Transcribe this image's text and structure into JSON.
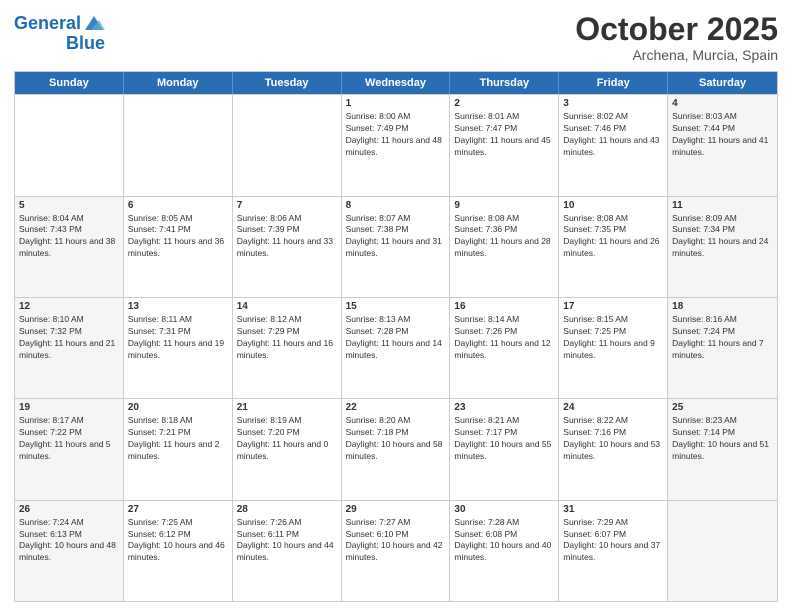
{
  "header": {
    "logo_general": "General",
    "logo_blue": "Blue",
    "month": "October 2025",
    "location": "Archena, Murcia, Spain"
  },
  "weekdays": [
    "Sunday",
    "Monday",
    "Tuesday",
    "Wednesday",
    "Thursday",
    "Friday",
    "Saturday"
  ],
  "rows": [
    [
      {
        "day": "",
        "sunrise": "",
        "sunset": "",
        "daylight": "",
        "shaded": false
      },
      {
        "day": "",
        "sunrise": "",
        "sunset": "",
        "daylight": "",
        "shaded": false
      },
      {
        "day": "",
        "sunrise": "",
        "sunset": "",
        "daylight": "",
        "shaded": false
      },
      {
        "day": "1",
        "sunrise": "Sunrise: 8:00 AM",
        "sunset": "Sunset: 7:49 PM",
        "daylight": "Daylight: 11 hours and 48 minutes.",
        "shaded": false
      },
      {
        "day": "2",
        "sunrise": "Sunrise: 8:01 AM",
        "sunset": "Sunset: 7:47 PM",
        "daylight": "Daylight: 11 hours and 45 minutes.",
        "shaded": false
      },
      {
        "day": "3",
        "sunrise": "Sunrise: 8:02 AM",
        "sunset": "Sunset: 7:46 PM",
        "daylight": "Daylight: 11 hours and 43 minutes.",
        "shaded": false
      },
      {
        "day": "4",
        "sunrise": "Sunrise: 8:03 AM",
        "sunset": "Sunset: 7:44 PM",
        "daylight": "Daylight: 11 hours and 41 minutes.",
        "shaded": true
      }
    ],
    [
      {
        "day": "5",
        "sunrise": "Sunrise: 8:04 AM",
        "sunset": "Sunset: 7:43 PM",
        "daylight": "Daylight: 11 hours and 38 minutes.",
        "shaded": true
      },
      {
        "day": "6",
        "sunrise": "Sunrise: 8:05 AM",
        "sunset": "Sunset: 7:41 PM",
        "daylight": "Daylight: 11 hours and 36 minutes.",
        "shaded": false
      },
      {
        "day": "7",
        "sunrise": "Sunrise: 8:06 AM",
        "sunset": "Sunset: 7:39 PM",
        "daylight": "Daylight: 11 hours and 33 minutes.",
        "shaded": false
      },
      {
        "day": "8",
        "sunrise": "Sunrise: 8:07 AM",
        "sunset": "Sunset: 7:38 PM",
        "daylight": "Daylight: 11 hours and 31 minutes.",
        "shaded": false
      },
      {
        "day": "9",
        "sunrise": "Sunrise: 8:08 AM",
        "sunset": "Sunset: 7:36 PM",
        "daylight": "Daylight: 11 hours and 28 minutes.",
        "shaded": false
      },
      {
        "day": "10",
        "sunrise": "Sunrise: 8:08 AM",
        "sunset": "Sunset: 7:35 PM",
        "daylight": "Daylight: 11 hours and 26 minutes.",
        "shaded": false
      },
      {
        "day": "11",
        "sunrise": "Sunrise: 8:09 AM",
        "sunset": "Sunset: 7:34 PM",
        "daylight": "Daylight: 11 hours and 24 minutes.",
        "shaded": true
      }
    ],
    [
      {
        "day": "12",
        "sunrise": "Sunrise: 8:10 AM",
        "sunset": "Sunset: 7:32 PM",
        "daylight": "Daylight: 11 hours and 21 minutes.",
        "shaded": true
      },
      {
        "day": "13",
        "sunrise": "Sunrise: 8:11 AM",
        "sunset": "Sunset: 7:31 PM",
        "daylight": "Daylight: 11 hours and 19 minutes.",
        "shaded": false
      },
      {
        "day": "14",
        "sunrise": "Sunrise: 8:12 AM",
        "sunset": "Sunset: 7:29 PM",
        "daylight": "Daylight: 11 hours and 16 minutes.",
        "shaded": false
      },
      {
        "day": "15",
        "sunrise": "Sunrise: 8:13 AM",
        "sunset": "Sunset: 7:28 PM",
        "daylight": "Daylight: 11 hours and 14 minutes.",
        "shaded": false
      },
      {
        "day": "16",
        "sunrise": "Sunrise: 8:14 AM",
        "sunset": "Sunset: 7:26 PM",
        "daylight": "Daylight: 11 hours and 12 minutes.",
        "shaded": false
      },
      {
        "day": "17",
        "sunrise": "Sunrise: 8:15 AM",
        "sunset": "Sunset: 7:25 PM",
        "daylight": "Daylight: 11 hours and 9 minutes.",
        "shaded": false
      },
      {
        "day": "18",
        "sunrise": "Sunrise: 8:16 AM",
        "sunset": "Sunset: 7:24 PM",
        "daylight": "Daylight: 11 hours and 7 minutes.",
        "shaded": true
      }
    ],
    [
      {
        "day": "19",
        "sunrise": "Sunrise: 8:17 AM",
        "sunset": "Sunset: 7:22 PM",
        "daylight": "Daylight: 11 hours and 5 minutes.",
        "shaded": true
      },
      {
        "day": "20",
        "sunrise": "Sunrise: 8:18 AM",
        "sunset": "Sunset: 7:21 PM",
        "daylight": "Daylight: 11 hours and 2 minutes.",
        "shaded": false
      },
      {
        "day": "21",
        "sunrise": "Sunrise: 8:19 AM",
        "sunset": "Sunset: 7:20 PM",
        "daylight": "Daylight: 11 hours and 0 minutes.",
        "shaded": false
      },
      {
        "day": "22",
        "sunrise": "Sunrise: 8:20 AM",
        "sunset": "Sunset: 7:18 PM",
        "daylight": "Daylight: 10 hours and 58 minutes.",
        "shaded": false
      },
      {
        "day": "23",
        "sunrise": "Sunrise: 8:21 AM",
        "sunset": "Sunset: 7:17 PM",
        "daylight": "Daylight: 10 hours and 55 minutes.",
        "shaded": false
      },
      {
        "day": "24",
        "sunrise": "Sunrise: 8:22 AM",
        "sunset": "Sunset: 7:16 PM",
        "daylight": "Daylight: 10 hours and 53 minutes.",
        "shaded": false
      },
      {
        "day": "25",
        "sunrise": "Sunrise: 8:23 AM",
        "sunset": "Sunset: 7:14 PM",
        "daylight": "Daylight: 10 hours and 51 minutes.",
        "shaded": true
      }
    ],
    [
      {
        "day": "26",
        "sunrise": "Sunrise: 7:24 AM",
        "sunset": "Sunset: 6:13 PM",
        "daylight": "Daylight: 10 hours and 48 minutes.",
        "shaded": true
      },
      {
        "day": "27",
        "sunrise": "Sunrise: 7:25 AM",
        "sunset": "Sunset: 6:12 PM",
        "daylight": "Daylight: 10 hours and 46 minutes.",
        "shaded": false
      },
      {
        "day": "28",
        "sunrise": "Sunrise: 7:26 AM",
        "sunset": "Sunset: 6:11 PM",
        "daylight": "Daylight: 10 hours and 44 minutes.",
        "shaded": false
      },
      {
        "day": "29",
        "sunrise": "Sunrise: 7:27 AM",
        "sunset": "Sunset: 6:10 PM",
        "daylight": "Daylight: 10 hours and 42 minutes.",
        "shaded": false
      },
      {
        "day": "30",
        "sunrise": "Sunrise: 7:28 AM",
        "sunset": "Sunset: 6:08 PM",
        "daylight": "Daylight: 10 hours and 40 minutes.",
        "shaded": false
      },
      {
        "day": "31",
        "sunrise": "Sunrise: 7:29 AM",
        "sunset": "Sunset: 6:07 PM",
        "daylight": "Daylight: 10 hours and 37 minutes.",
        "shaded": false
      },
      {
        "day": "",
        "sunrise": "",
        "sunset": "",
        "daylight": "",
        "shaded": true
      }
    ]
  ]
}
